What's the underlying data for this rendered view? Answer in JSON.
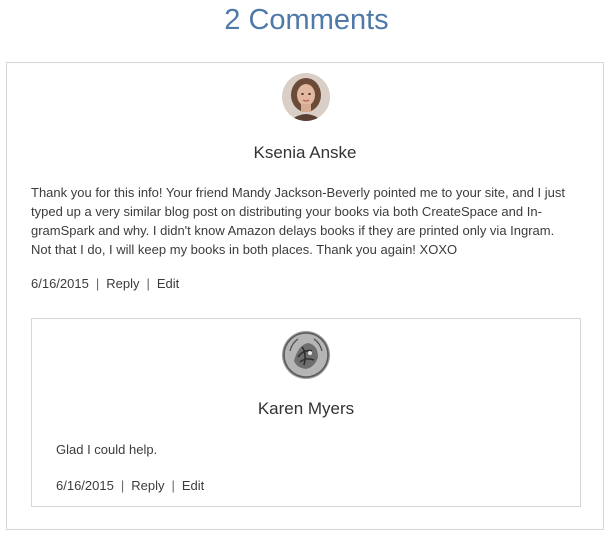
{
  "title": "2 Comments",
  "comments": [
    {
      "author": "Ksenia Anske",
      "text": "Thank you for this info! Your friend Mandy Jackson-Beverly pointed me to your site, and I just typed up a very similar blog post on distributing your books via both CreateSpace and In-gramSpark and why. I didn't know Amazon delays books if they are printed only via Ingram. Not that I do, I will keep my books in both places. Thank you again! XOXO",
      "date": "6/16/2015",
      "reply_label": "Reply",
      "edit_label": "Edit",
      "separator": "|"
    },
    {
      "author": "Karen Myers",
      "text": "Glad I could help.",
      "date": "6/16/2015",
      "reply_label": "Reply",
      "edit_label": "Edit",
      "separator": "|"
    }
  ]
}
